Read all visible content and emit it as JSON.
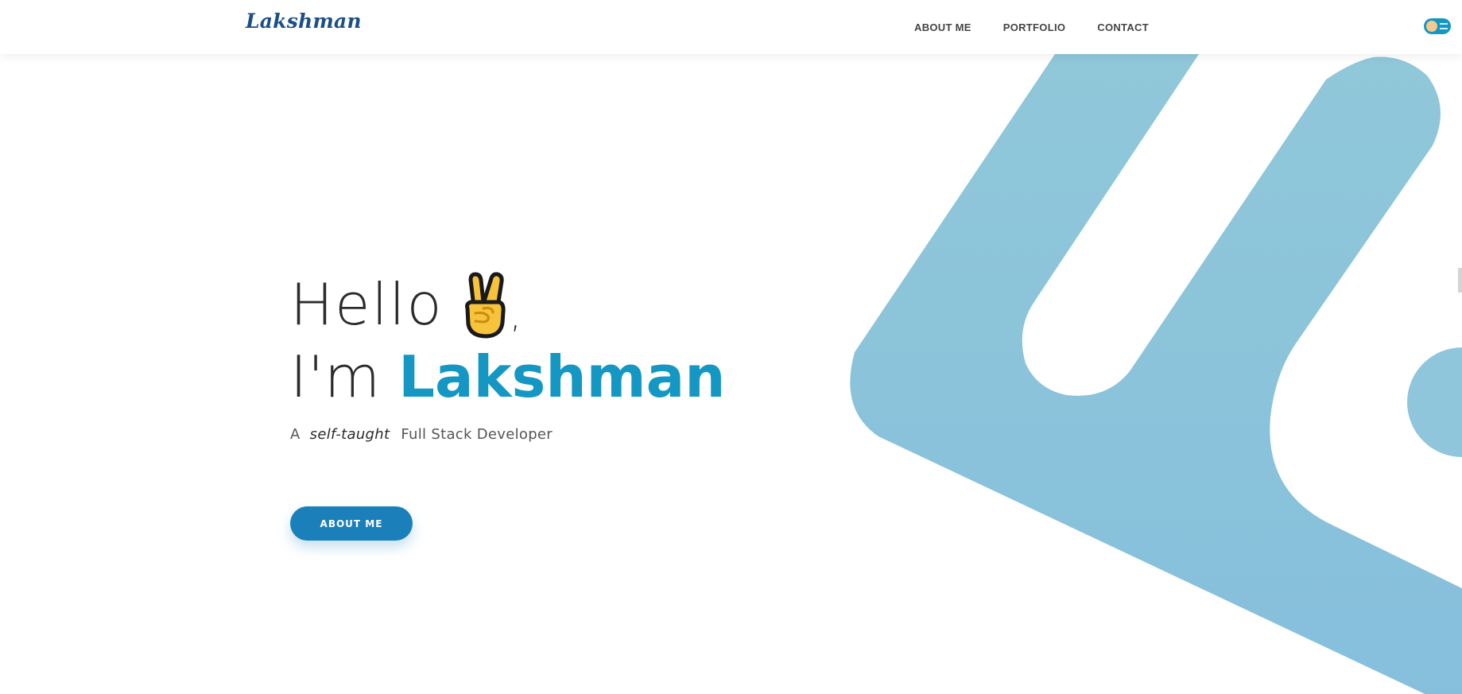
{
  "nav": {
    "logo": "Lakshman",
    "links": [
      "ABOUT ME",
      "PORTFOLIO",
      "CONTACT"
    ]
  },
  "hero": {
    "greeting": "Hello",
    "comma": ",",
    "intro": "I'm",
    "name": "Lakshman",
    "tagline_prefix": "A",
    "tagline_emphasis": "self-taught",
    "tagline_suffix": "Full Stack Developer",
    "cta_label": "ABOUT ME"
  },
  "icons": {
    "greeting_emoji": "victory-hand-icon",
    "theme_toggle": "theme-toggle-icon"
  },
  "colors": {
    "accent": "#1597c4",
    "button": "#1b80ba",
    "logo": "#1c4f86",
    "shape": "#8cc6db"
  }
}
